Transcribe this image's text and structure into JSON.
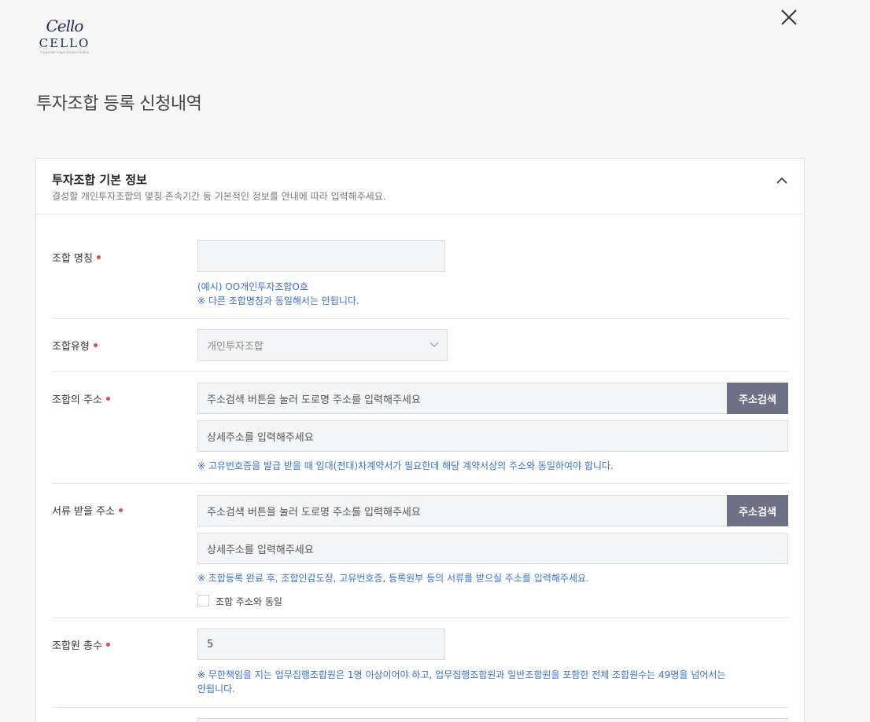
{
  "logo": {
    "script": "Cello",
    "word": "CELLO",
    "tagline": "Corporate Legal Service Online"
  },
  "page_title": "투자조합 등록 신청내역",
  "section": {
    "title": "투자조합 기본 정보",
    "subtitle": "결성할 개인투자조합의 몇칭 존속기간 등 기본적인 정보를 안내에 따라 입력해주세요."
  },
  "fields": {
    "name": {
      "label": "조합 명칭",
      "value": "",
      "note1": "(예시) OO개인투자조합O호",
      "note2": "※ 다른 조합명칭과 동일해서는 안됩니다."
    },
    "type": {
      "label": "조합유형",
      "value": "개인투자조합"
    },
    "address": {
      "label": "조합의 주소",
      "placeholder": "주소검색 버튼을 눌러 도로명 주소를 입력해주세요",
      "detail_placeholder": "상세주소를 입력해주세요",
      "search_label": "주소검색",
      "note": "※ 고유번호증을 발급 받을 때 임대(전대)차계약서가 필요한데 해당 계약서상의 주소와 동일하여야 합니다."
    },
    "mail_address": {
      "label": "서류 받을 주소",
      "placeholder": "주소검색 버튼을 눌러 도로명 주소를 입력해주세요",
      "detail_placeholder": "상세주소를 입력해주세요",
      "search_label": "주소검색",
      "note": "※ 조합등록 완료 후, 조합인감도장, 고유번호증, 등록원부 등의 서류를 받으실 주소를 입력해주세요.",
      "same_checkbox_label": "조합 주소와 동일"
    },
    "members": {
      "label": "조합원 총수",
      "value": "5",
      "note1": "※ 무한책임을 지는 업무집행조합원은 1명 이상이어야 하고, 업무집행조합원과 일반조합원을 포함한 전체 조합원수는 49명을 넘어서는",
      "note2": "안됩니다."
    }
  },
  "colors": {
    "accent": "#3b6fd4",
    "required": "#e5484d",
    "button": "#6c7185"
  }
}
